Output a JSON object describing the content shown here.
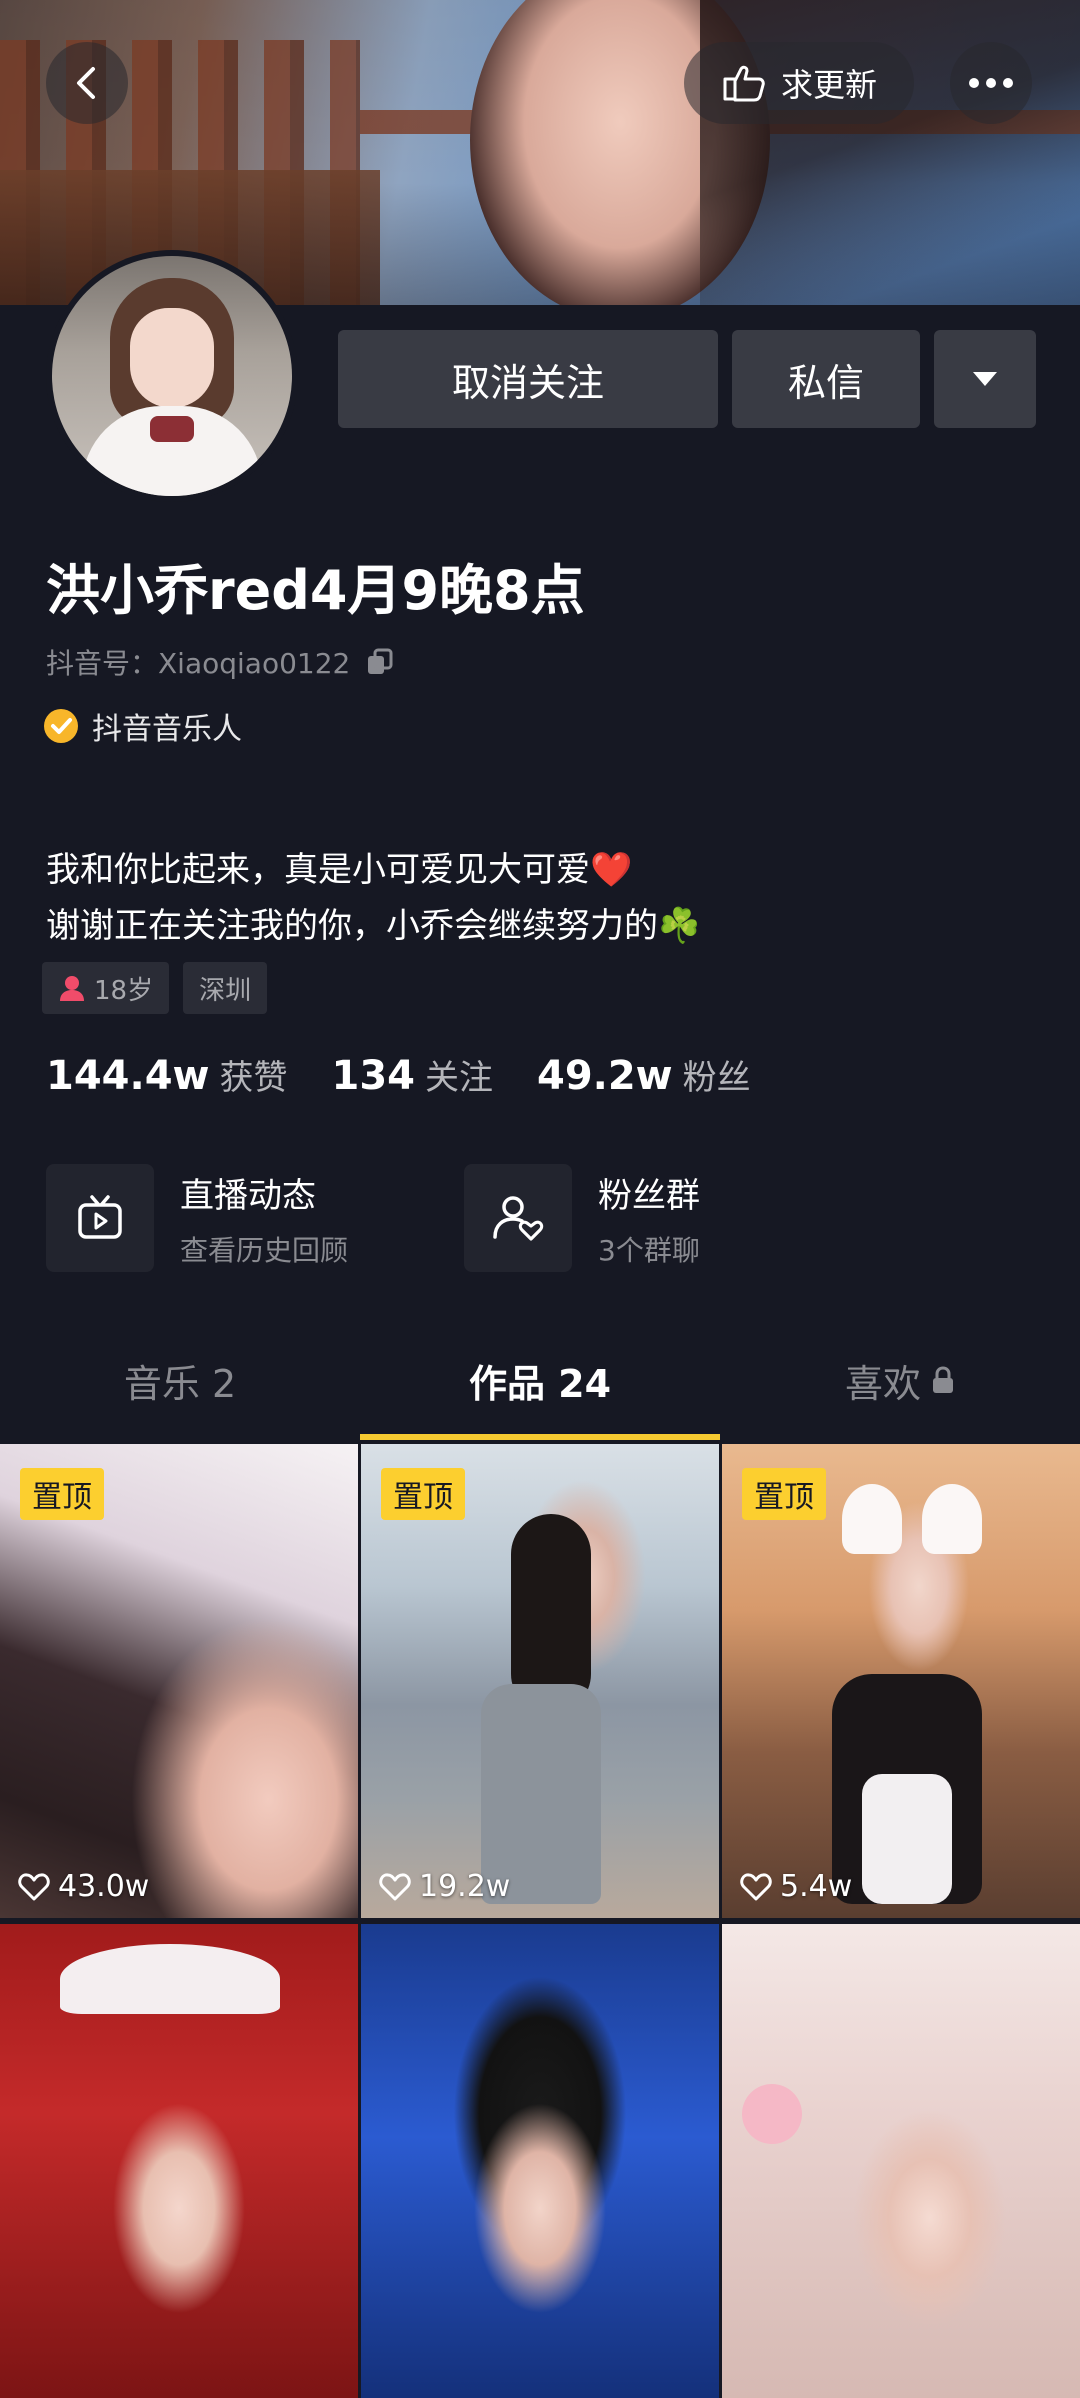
{
  "header": {
    "update_label": "求更新"
  },
  "profile": {
    "nickname": "洪小乔red4月9晚8点",
    "douyin_id": "抖音号：Xiaoqiao0122",
    "verified_label": "抖音音乐人",
    "bio_line1": "我和你比起来，真是小可爱见大可爱❤️",
    "bio_line2": "谢谢正在关注我的你，小乔会继续努力的☘️",
    "tags": {
      "age": "18岁",
      "city": "深圳"
    }
  },
  "actions": {
    "unfollow_label": "取消关注",
    "message_label": "私信"
  },
  "stats": {
    "likes_num": "144.4w",
    "likes_label": "获赞",
    "following_num": "134",
    "following_label": "关注",
    "followers_num": "49.2w",
    "followers_label": "粉丝"
  },
  "cards": {
    "live": {
      "title": "直播动态",
      "subtitle": "查看历史回顾"
    },
    "fans": {
      "title": "粉丝群",
      "subtitle": "3个群聊"
    }
  },
  "tabs": {
    "music": "音乐 2",
    "works": "作品 24",
    "likes": "喜欢",
    "active": "works"
  },
  "videos": [
    {
      "pinned": "置顶",
      "likes": "43.0w"
    },
    {
      "pinned": "置顶",
      "likes": "19.2w"
    },
    {
      "pinned": "置顶",
      "likes": "5.4w"
    },
    {
      "pinned": "",
      "likes": ""
    },
    {
      "pinned": "",
      "likes": ""
    },
    {
      "pinned": "",
      "likes": ""
    }
  ],
  "colors": {
    "background": "#161823",
    "button": "#393b44",
    "accent_yellow": "#f6ca31",
    "verified_badge": "#f8b62a",
    "gender_female": "#f04c6a"
  },
  "icons": {
    "back": "chevron-left-icon",
    "update": "hand-point-icon",
    "more": "more-dots-icon",
    "copy": "copy-icon",
    "verified": "verified-check-icon",
    "dropdown": "triangle-down-icon",
    "live": "tv-play-icon",
    "fans": "group-heart-icon",
    "lock": "lock-icon",
    "heart": "heart-outline-icon"
  }
}
